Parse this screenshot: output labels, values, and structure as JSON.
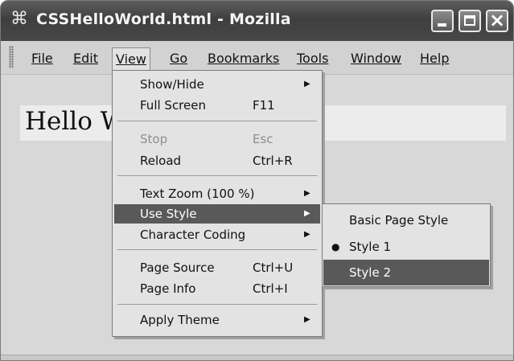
{
  "window": {
    "title": "CSSHelloWorld.html - Mozilla",
    "app_icon": "mozilla-app-icon",
    "controls": {
      "minimize": "minimize-icon",
      "maximize": "maximize-icon",
      "close": "close-icon"
    }
  },
  "menubar": {
    "items": [
      {
        "label": "File"
      },
      {
        "label": "Edit"
      },
      {
        "label": "View"
      },
      {
        "label": "Go"
      },
      {
        "label": "Bookmarks"
      },
      {
        "label": "Tools"
      },
      {
        "label": "Window"
      },
      {
        "label": "Help"
      }
    ],
    "open_menu": "View"
  },
  "page": {
    "hello_text": "Hello World"
  },
  "view_menu": {
    "items": [
      {
        "label": "Show/Hide",
        "shortcut": "",
        "submenu": true,
        "enabled": true
      },
      {
        "label": "Full Screen",
        "shortcut": "F11",
        "submenu": false,
        "enabled": true
      },
      {
        "label": "Stop",
        "shortcut": "Esc",
        "submenu": false,
        "enabled": false
      },
      {
        "label": "Reload",
        "shortcut": "Ctrl+R",
        "submenu": false,
        "enabled": true
      },
      {
        "label": "Text Zoom (100 %)",
        "shortcut": "",
        "submenu": true,
        "enabled": true
      },
      {
        "label": "Use Style",
        "shortcut": "",
        "submenu": true,
        "enabled": true,
        "highlighted": true
      },
      {
        "label": "Character Coding",
        "shortcut": "",
        "submenu": true,
        "enabled": true
      },
      {
        "label": "Page Source",
        "shortcut": "Ctrl+U",
        "submenu": false,
        "enabled": true
      },
      {
        "label": "Page Info",
        "shortcut": "Ctrl+I",
        "submenu": false,
        "enabled": true
      },
      {
        "label": "Apply Theme",
        "shortcut": "",
        "submenu": true,
        "enabled": true
      }
    ],
    "submenu_arrow": "▶"
  },
  "use_style_submenu": {
    "items": [
      {
        "label": "Basic Page Style",
        "checked": false,
        "highlighted": false
      },
      {
        "label": "Style 1",
        "checked": true,
        "highlighted": false
      },
      {
        "label": "Style 2",
        "checked": false,
        "highlighted": true
      }
    ],
    "bullet": "●"
  },
  "colors": {
    "titlebar": "#474747",
    "menu_highlight": "#595959",
    "menu_background": "#e3e3e3",
    "disabled_text": "#8e8e8e"
  }
}
